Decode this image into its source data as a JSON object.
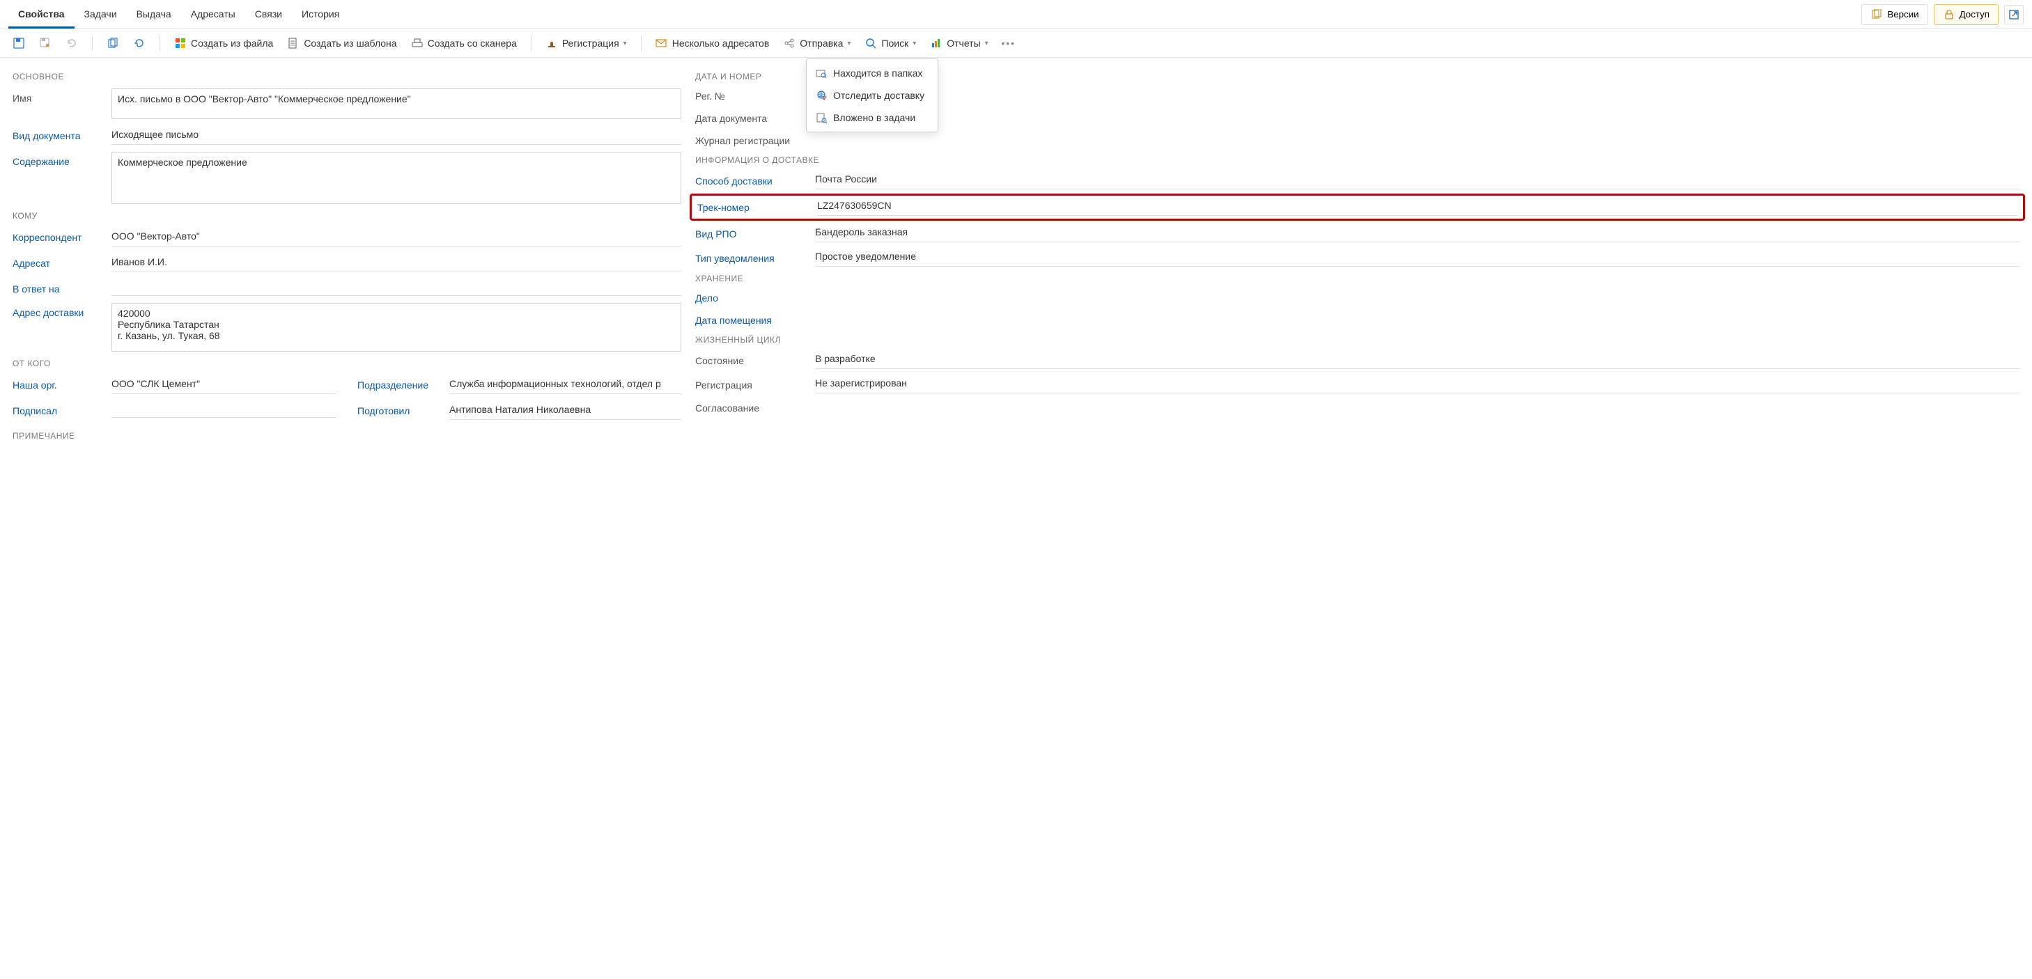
{
  "tabs": [
    "Свойства",
    "Задачи",
    "Выдача",
    "Адресаты",
    "Связи",
    "История"
  ],
  "active_tab_index": 0,
  "header_buttons": {
    "versions": "Версии",
    "access": "Доступ"
  },
  "toolbar": {
    "create_from_file": "Создать из файла",
    "create_from_template": "Создать из шаблона",
    "create_from_scanner": "Создать со сканера",
    "registration": "Регистрация",
    "multiple_recipients": "Несколько адресатов",
    "sending": "Отправка",
    "search": "Поиск",
    "reports": "Отчеты"
  },
  "search_popup": [
    "Находится в папках",
    "Отследить доставку",
    "Вложено в задачи"
  ],
  "left": {
    "section_main": "ОСНОВНОЕ",
    "name_label": "Имя",
    "name_value": "Исх. письмо в ООО \"Вектор-Авто\" \"Коммерческое предложение\"",
    "doc_kind_label": "Вид документа",
    "doc_kind_value": "Исходящее письмо",
    "subject_label": "Содержание",
    "subject_value": "Коммерческое предложение",
    "section_to": "КОМУ",
    "corr_label": "Корреспондент",
    "corr_value": "ООО \"Вектор-Авто\"",
    "addressee_label": "Адресат",
    "addressee_value": "Иванов И.И.",
    "reply_to_label": "В ответ на",
    "delivery_addr_label": "Адрес доставки",
    "delivery_addr_value": "420000\nРеспублика Татарстан\nг. Казань, ул. Тукая, 68",
    "section_from": "ОТ КОГО",
    "our_org_label": "Наша орг.",
    "our_org_value": "ООО \"СЛК Цемент\"",
    "department_label": "Подразделение",
    "department_value": "Служба информационных технологий, отдел р",
    "signed_label": "Подписал",
    "prepared_label": "Подготовил",
    "prepared_value": "Антипова Наталия Николаевна",
    "section_note": "ПРИМЕЧАНИЕ"
  },
  "right": {
    "section_date": "ДАТА И НОМЕР",
    "reg_no_label": "Рег. №",
    "doc_date_label": "Дата документа",
    "reg_log_label": "Журнал регистрации",
    "section_delivery": "ИНФОРМАЦИЯ О ДОСТАВКЕ",
    "delivery_method_label": "Способ доставки",
    "delivery_method_value": "Почта России",
    "track_label": "Трек-номер",
    "track_value": "LZ247630659CN",
    "rpo_label": "Вид РПО",
    "rpo_value": "Бандероль заказная",
    "notice_type_label": "Тип уведомления",
    "notice_type_value": "Простое уведомление",
    "section_storage": "ХРАНЕНИЕ",
    "case_label": "Дело",
    "placed_date_label": "Дата помещения",
    "section_lifecycle": "ЖИЗНЕННЫЙ ЦИКЛ",
    "state_label": "Состояние",
    "state_value": "В разработке",
    "reg_label": "Регистрация",
    "reg_value": "Не зарегистрирован",
    "approval_label": "Согласование"
  }
}
